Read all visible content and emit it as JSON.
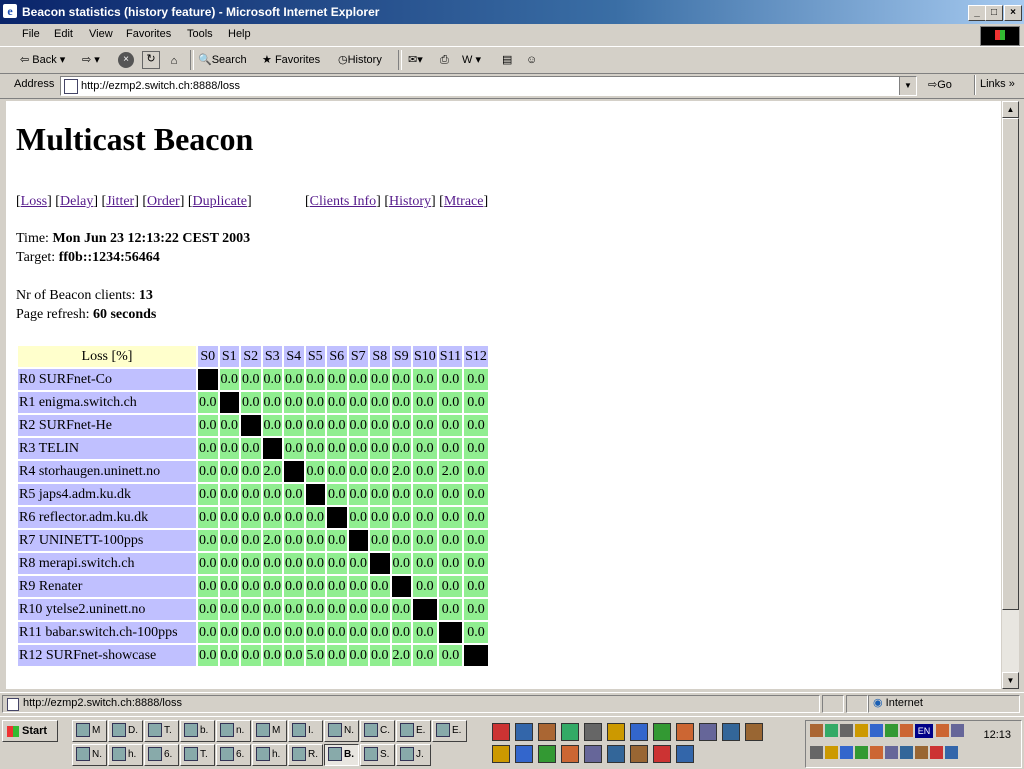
{
  "window": {
    "title": "Beacon statistics (history feature) - Microsoft Internet Explorer"
  },
  "menu": [
    "File",
    "Edit",
    "View",
    "Favorites",
    "Tools",
    "Help"
  ],
  "toolbar": {
    "back": "Back",
    "search": "Search",
    "favorites": "Favorites",
    "history": "History"
  },
  "address": {
    "label": "Address",
    "url": "http://ezmp2.switch.ch:8888/loss",
    "go": "Go",
    "links": "Links"
  },
  "page": {
    "heading": "Multicast Beacon",
    "nav_left": [
      "Loss",
      "Delay",
      "Jitter",
      "Order",
      "Duplicate"
    ],
    "nav_right": [
      "Clients Info",
      "History",
      "Mtrace"
    ],
    "time_label": "Time: ",
    "time_value": "Mon Jun 23 12:13:22 CEST 2003",
    "target_label": "Target: ",
    "target_value": "ff0b::1234:56464",
    "clients_label": "Nr of Beacon clients: ",
    "clients_value": "13",
    "refresh_label": "Page refresh: ",
    "refresh_value": "60 seconds"
  },
  "table": {
    "corner": "Loss [%]",
    "columns": [
      "S0",
      "S1",
      "S2",
      "S3",
      "S4",
      "S5",
      "S6",
      "S7",
      "S8",
      "S9",
      "S10",
      "S11",
      "S12"
    ],
    "rows": [
      {
        "label": "R0 SURFnet-Co",
        "values": [
          null,
          "0.0",
          "0.0",
          "0.0",
          "0.0",
          "0.0",
          "0.0",
          "0.0",
          "0.0",
          "0.0",
          "0.0",
          "0.0",
          "0.0"
        ]
      },
      {
        "label": "R1 enigma.switch.ch",
        "values": [
          "0.0",
          null,
          "0.0",
          "0.0",
          "0.0",
          "0.0",
          "0.0",
          "0.0",
          "0.0",
          "0.0",
          "0.0",
          "0.0",
          "0.0"
        ]
      },
      {
        "label": "R2 SURFnet-He",
        "values": [
          "0.0",
          "0.0",
          null,
          "0.0",
          "0.0",
          "0.0",
          "0.0",
          "0.0",
          "0.0",
          "0.0",
          "0.0",
          "0.0",
          "0.0"
        ]
      },
      {
        "label": "R3 TELIN",
        "values": [
          "0.0",
          "0.0",
          "0.0",
          null,
          "0.0",
          "0.0",
          "0.0",
          "0.0",
          "0.0",
          "0.0",
          "0.0",
          "0.0",
          "0.0"
        ]
      },
      {
        "label": "R4 storhaugen.uninett.no",
        "values": [
          "0.0",
          "0.0",
          "0.0",
          "2.0",
          null,
          "0.0",
          "0.0",
          "0.0",
          "0.0",
          "2.0",
          "0.0",
          "2.0",
          "0.0"
        ]
      },
      {
        "label": "R5 japs4.adm.ku.dk",
        "values": [
          "0.0",
          "0.0",
          "0.0",
          "0.0",
          "0.0",
          null,
          "0.0",
          "0.0",
          "0.0",
          "0.0",
          "0.0",
          "0.0",
          "0.0"
        ]
      },
      {
        "label": "R6 reflector.adm.ku.dk",
        "values": [
          "0.0",
          "0.0",
          "0.0",
          "0.0",
          "0.0",
          "0.0",
          null,
          "0.0",
          "0.0",
          "0.0",
          "0.0",
          "0.0",
          "0.0"
        ]
      },
      {
        "label": "R7 UNINETT-100pps",
        "values": [
          "0.0",
          "0.0",
          "0.0",
          "2.0",
          "0.0",
          "0.0",
          "0.0",
          null,
          "0.0",
          "0.0",
          "0.0",
          "0.0",
          "0.0"
        ]
      },
      {
        "label": "R8 merapi.switch.ch",
        "values": [
          "0.0",
          "0.0",
          "0.0",
          "0.0",
          "0.0",
          "0.0",
          "0.0",
          "0.0",
          null,
          "0.0",
          "0.0",
          "0.0",
          "0.0"
        ]
      },
      {
        "label": "R9 Renater",
        "values": [
          "0.0",
          "0.0",
          "0.0",
          "0.0",
          "0.0",
          "0.0",
          "0.0",
          "0.0",
          "0.0",
          null,
          "0.0",
          "0.0",
          "0.0"
        ]
      },
      {
        "label": "R10 ytelse2.uninett.no",
        "values": [
          "0.0",
          "0.0",
          "0.0",
          "0.0",
          "0.0",
          "0.0",
          "0.0",
          "0.0",
          "0.0",
          "0.0",
          null,
          "0.0",
          "0.0"
        ]
      },
      {
        "label": "R11 babar.switch.ch-100pps",
        "values": [
          "0.0",
          "0.0",
          "0.0",
          "0.0",
          "0.0",
          "0.0",
          "0.0",
          "0.0",
          "0.0",
          "0.0",
          "0.0",
          null,
          "0.0"
        ]
      },
      {
        "label": "R12 SURFnet-showcase",
        "values": [
          "0.0",
          "0.0",
          "0.0",
          "0.0",
          "0.0",
          "5.0",
          "0.0",
          "0.0",
          "0.0",
          "2.0",
          "0.0",
          "0.0",
          null
        ]
      }
    ]
  },
  "colors": {
    "header": "#ffffcc",
    "label_cell": "#c0c0ff",
    "value_cell": "#90ee90",
    "self_cell": "#000000"
  },
  "statusbar": {
    "url": "http://ezmp2.switch.ch:8888/loss",
    "zone": "Internet"
  },
  "taskbar": {
    "start": "Start",
    "clock": "12:13",
    "language": "EN",
    "row1": [
      "M",
      "D.",
      "T.",
      "b.",
      "n.",
      "M",
      "I.",
      "N.",
      "C.",
      "E.",
      "E."
    ],
    "row2": [
      "N.",
      "h.",
      "6.",
      "T.",
      "6.",
      "h.",
      "R.",
      "B.",
      "S.",
      "J."
    ]
  }
}
